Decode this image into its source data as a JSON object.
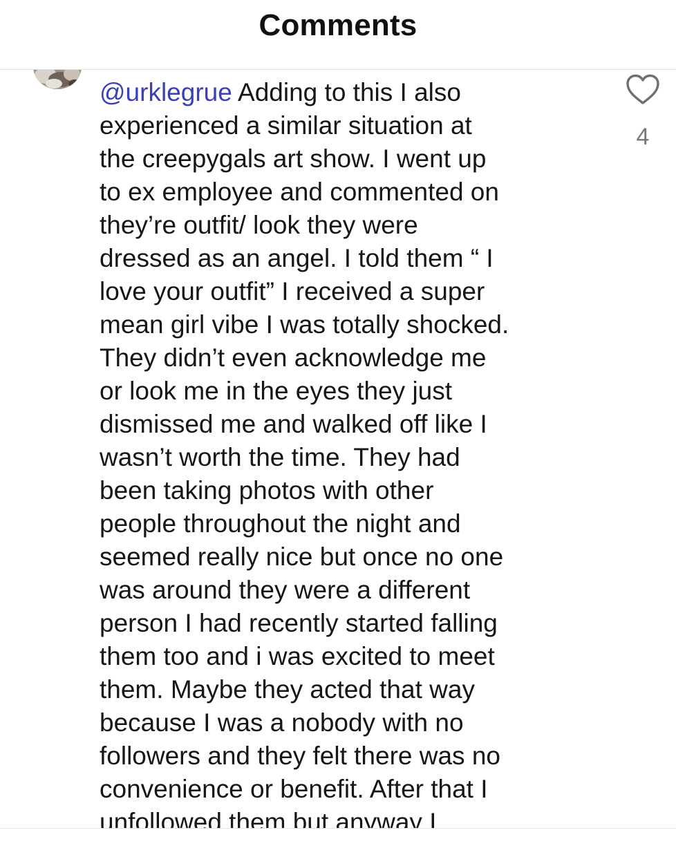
{
  "header": {
    "title": "Comments"
  },
  "comment": {
    "mention": "@urklegrue",
    "first_line_rest": " Adding to this I also",
    "lines": [
      "experienced a similar situation at",
      "the creepygals art show. I went up",
      "to ex employee and commented on",
      "they’re outfit/ look they were",
      "dressed as an angel. I told them “ I",
      "love your outfit” I received a super",
      "mean girl vibe I was totally shocked.",
      "They didn’t even acknowledge me",
      "or look me in the eyes they just",
      "dismissed me and walked off like I",
      "wasn’t worth the time. They had",
      "been taking photos with other",
      "people throughout the night and",
      "seemed really nice but once no one",
      "was around they were a different",
      "person I had recently started falling",
      "them too and i was excited to meet",
      "them. Maybe they acted that way",
      "because I was a nobody with no",
      "followers and they felt there was no",
      "convenience or benefit. After that I",
      "unfollowed them but anyway I"
    ],
    "like_icon": "heart-outline-icon",
    "like_count": "4"
  },
  "colors": {
    "mention": "#3b3fb8",
    "text": "#161616",
    "muted": "#777777",
    "divider": "#e2e2e2"
  }
}
